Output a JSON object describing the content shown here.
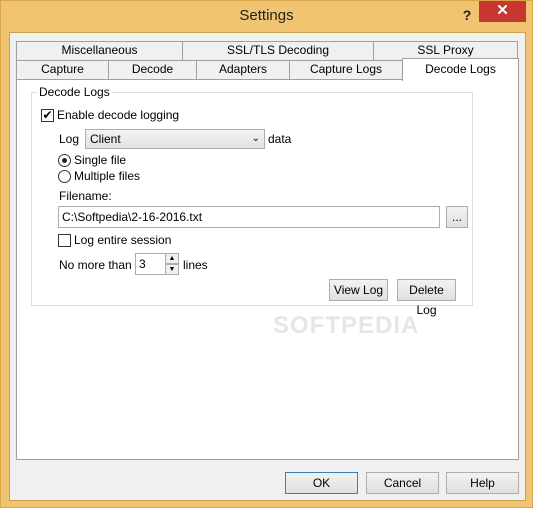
{
  "window": {
    "title": "Settings",
    "help_glyph": "?",
    "close_glyph": "✕"
  },
  "tabs": {
    "row_top": [
      "Miscellaneous",
      "SSL/TLS Decoding",
      "SSL Proxy"
    ],
    "row_bottom": [
      "Capture",
      "Decode",
      "Adapters",
      "Capture Logs",
      "Decode Logs"
    ],
    "active": "Decode Logs"
  },
  "decode_logs": {
    "group_title": "Decode Logs",
    "enable_logging": {
      "label": "Enable decode logging",
      "checked": true
    },
    "log_label": "Log",
    "log_select": {
      "value": "Client"
    },
    "data_label": "data",
    "single_file": {
      "label": "Single file",
      "selected": true
    },
    "multiple_files": {
      "label": "Multiple files",
      "selected": false
    },
    "filename_label": "Filename:",
    "filename_value": "C:\\Softpedia\\2-16-2016.txt",
    "browse_label": "...",
    "log_entire_session": {
      "label": "Log entire session",
      "checked": false
    },
    "no_more_than_label": "No more than",
    "lines_value": "3",
    "lines_label": "lines",
    "view_log_label": "View Log",
    "delete_log_label": "Delete Log"
  },
  "footer": {
    "ok_label": "OK",
    "cancel_label": "Cancel",
    "help_label": "Help"
  },
  "watermark": "SOFTPEDIA",
  "colors": {
    "title_bar": "#f0c470",
    "close_button": "#c7372f",
    "panel": "#f0f0f0"
  },
  "icons": {
    "checkmark": "✔",
    "dropdown": "⌄",
    "spin_up": "▲",
    "spin_down": "▼"
  }
}
